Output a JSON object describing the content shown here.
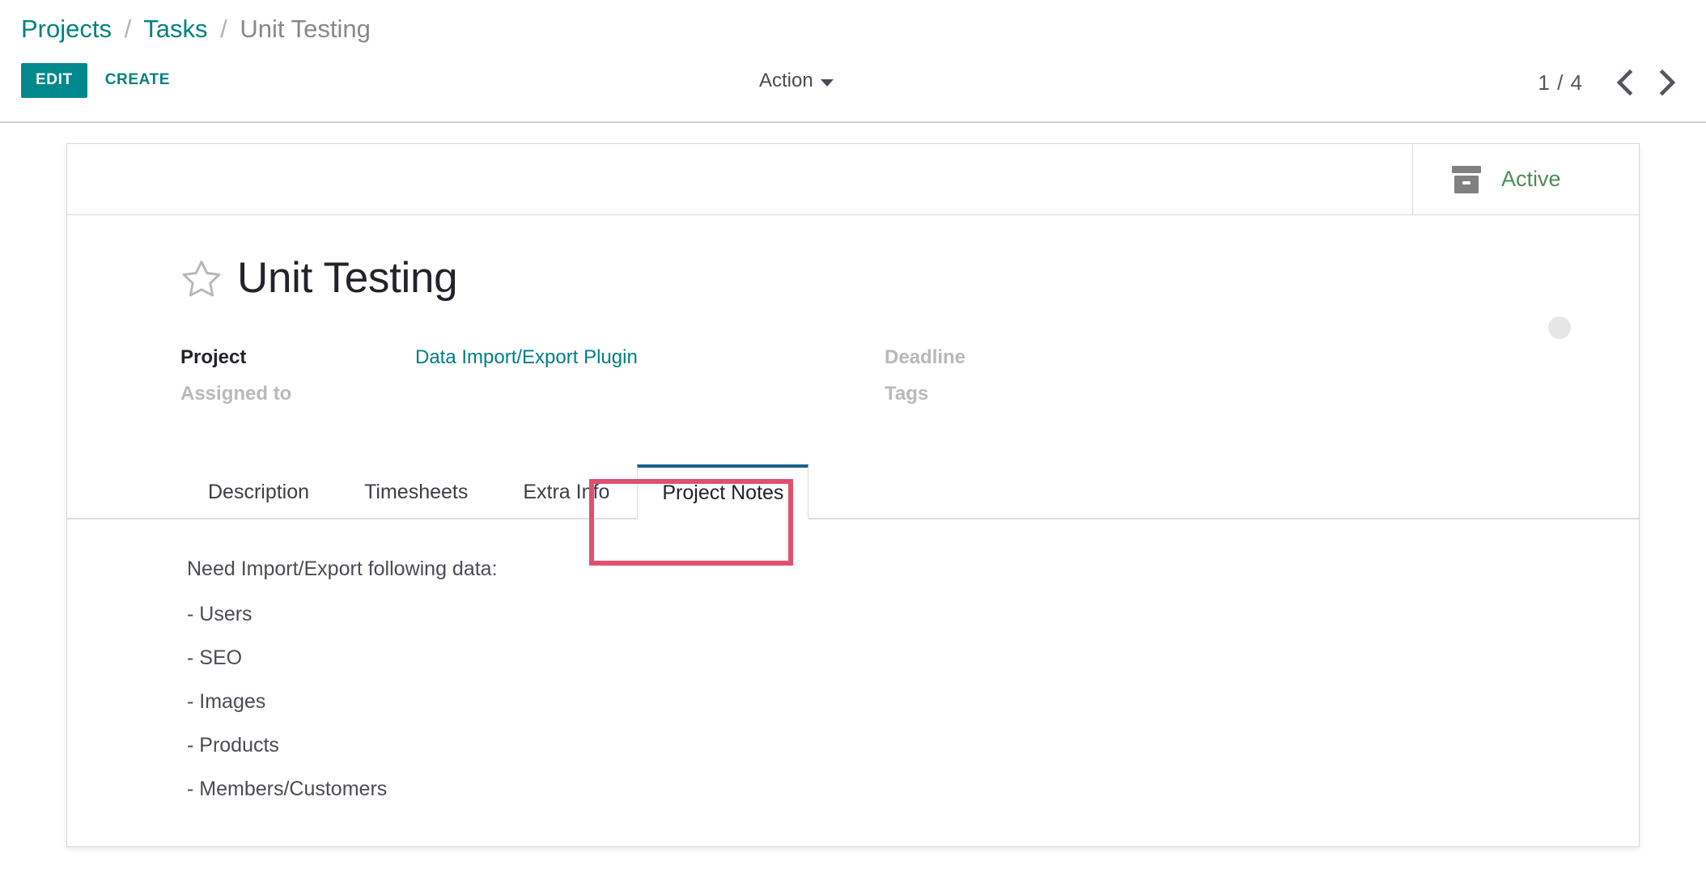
{
  "header": {
    "breadcrumb": {
      "items": [
        {
          "label": "Projects",
          "type": "link"
        },
        {
          "label": "Tasks",
          "type": "link"
        },
        {
          "label": "Unit Testing",
          "type": "current"
        }
      ],
      "separator": "/"
    },
    "buttons": {
      "edit_label": "EDIT",
      "create_label": "CREATE"
    },
    "action_menu": {
      "label": "Action",
      "icon": "caret-down-icon"
    },
    "pager": {
      "counter": "1 / 4",
      "previous_icon": "chevron-left-icon",
      "next_icon": "chevron-right-icon"
    }
  },
  "statusbar": {
    "archive_button": {
      "icon": "archive-box-icon",
      "label": "Active",
      "color": "#4e8b5c"
    }
  },
  "record": {
    "favorite_icon": "star-outline-icon",
    "title": "Unit Testing",
    "kanban_state_icon": "circle-dot-icon"
  },
  "fields": {
    "left": [
      {
        "label": "Project",
        "value": "Data Import/Export Plugin",
        "value_type": "link",
        "empty": false
      },
      {
        "label": "Assigned to",
        "value": "",
        "value_type": "text",
        "empty": true
      }
    ],
    "right": [
      {
        "label": "Deadline",
        "value": "",
        "value_type": "text",
        "empty": true
      },
      {
        "label": "Tags",
        "value": "",
        "value_type": "text",
        "empty": true
      }
    ]
  },
  "notebook": {
    "tabs": [
      {
        "label": "Description",
        "active": false
      },
      {
        "label": "Timesheets",
        "active": false
      },
      {
        "label": "Extra Info",
        "active": false
      },
      {
        "label": "Project Notes",
        "active": true
      }
    ],
    "active_tab_highlight_color": "#e1506f",
    "active_tab_border_color": "#1c5f8b",
    "content": {
      "lines": [
        "Need Import/Export following data:",
        "- Users",
        "- SEO",
        "- Images",
        "- Products",
        "- Members/Customers"
      ]
    }
  },
  "colors": {
    "accent_teal": "#00898c",
    "link_teal": "#017e84",
    "highlight_pink": "#e1506f",
    "active_tab_blue": "#1c5f8b",
    "status_green": "#4e8b5c"
  }
}
